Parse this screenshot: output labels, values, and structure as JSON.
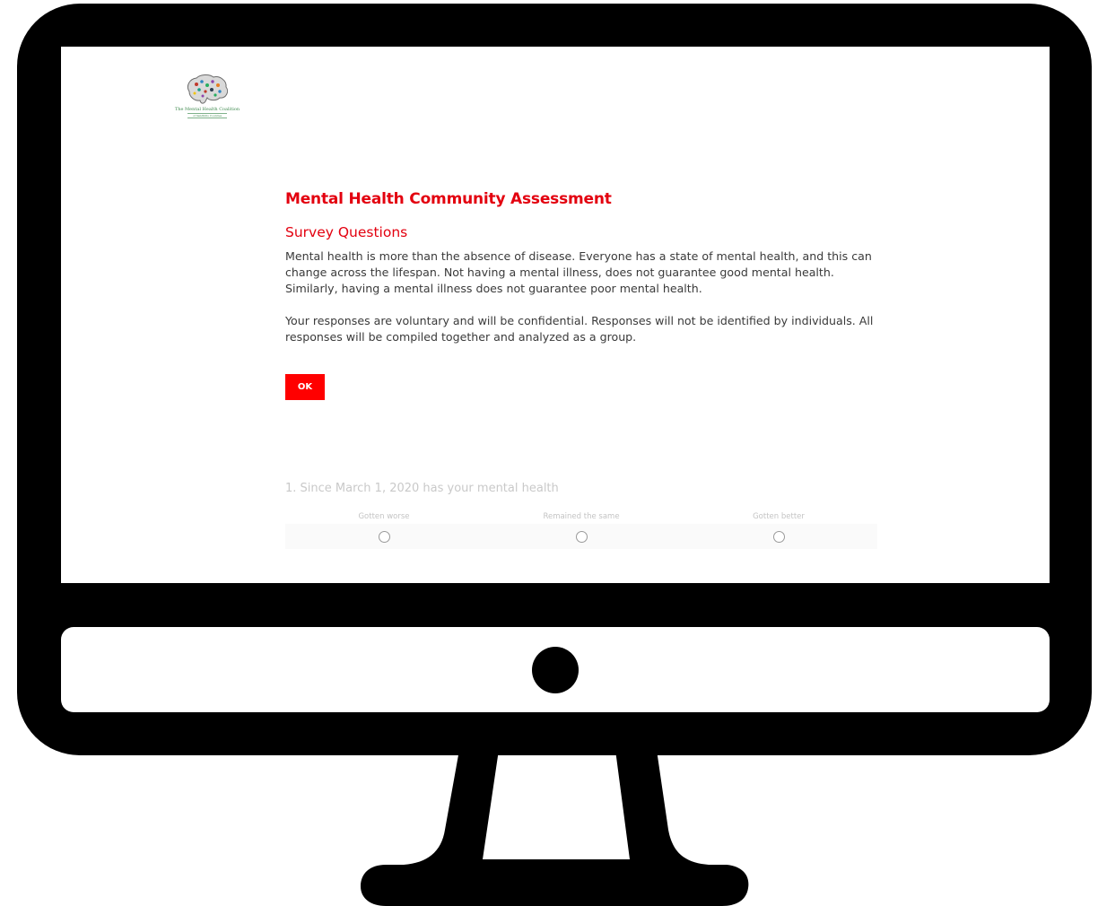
{
  "logo": {
    "name": "The Mental Health Coalition",
    "subtitle": "of Sandhills Counties"
  },
  "survey": {
    "title": "Mental Health Community Assessment",
    "section_title": "Survey Questions",
    "intro_paragraph_1": "Mental health is more than the absence of disease. Everyone has a state of mental health, and this can change across the lifespan. Not having a mental illness, does not guarantee good mental health. Similarly, having a mental illness does not guarantee poor mental health.",
    "intro_paragraph_2": "Your responses are voluntary and will be confidential. Responses will not be identified by individuals. All responses will be compiled together and analyzed as a group.",
    "ok_label": "OK"
  },
  "question_1": {
    "text": "1. Since March 1, 2020 has your mental health",
    "options": [
      "Gotten worse",
      "Remained the same",
      "Gotten better"
    ]
  },
  "colors": {
    "accent": "#e3000f",
    "button": "#ff0000",
    "frame": "#000000"
  }
}
